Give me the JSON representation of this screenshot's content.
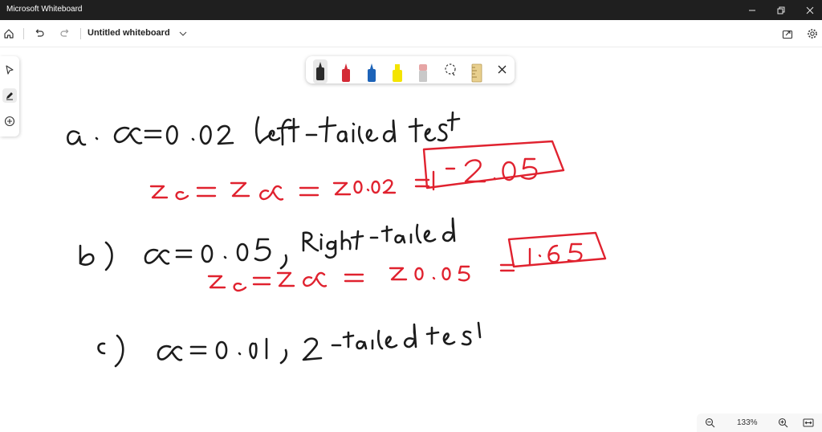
{
  "window": {
    "title": "Microsoft Whiteboard"
  },
  "toolbar": {
    "doc_title": "Untitled whiteboard"
  },
  "inking": {
    "pen_colors": [
      "#2b2b2b",
      "#d42a35",
      "#1d63b8",
      "#f4e400",
      "#e6a5a5"
    ]
  },
  "board": {
    "ink_colors": {
      "black": "#1c1c1c",
      "red": "#e0222f"
    },
    "lines": [
      "a. α = 0.02 left-tailed test",
      "Zc = Zα = Z0.02 = -2.05",
      "b) α = 0.05, Right-tailed",
      "Zc = Zα = Z0.05 = 1.65",
      "c) α = 0.01, 2-tailed test"
    ]
  },
  "status": {
    "zoom": "133%"
  }
}
